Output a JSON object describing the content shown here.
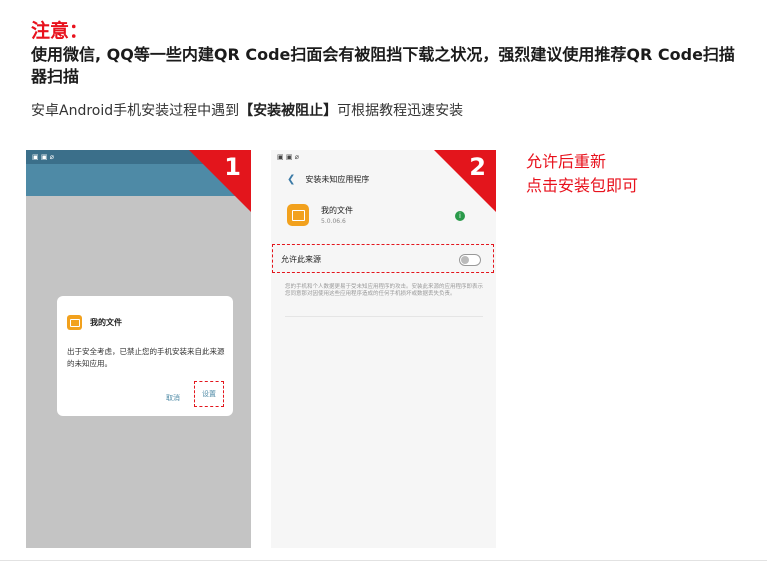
{
  "notice": {
    "title": "注意：",
    "warning": "使用微信, QQ等一些内建QR Code扫面会有被阻挡下载之状况，强烈建议使用推荐QR Code扫描器扫描",
    "sub_pre": "安卓Android手机安装过程中遇到",
    "sub_bold": "【安装被阻止】",
    "sub_post": "可根据教程迅速安装"
  },
  "phone1": {
    "status_left": "▣ ▣ ⌀",
    "status_right": "◀ ▣ ≋ .ıl 10",
    "step": "1",
    "dialog_title": "我的文件",
    "dialog_message": "出于安全考虑，已禁止您的手机安装来自此来源的未知应用。",
    "cancel": "取消",
    "settings": "设置"
  },
  "phone2": {
    "status_left": "▣ ▣ ⌀",
    "status_right": "◀ ▣ ≋ .ıl 10",
    "step": "2",
    "title": "安装未知应用程序",
    "app_name": "我的文件",
    "app_version": "5.0.06.6",
    "allow_label": "允许此来源",
    "description": "您的手机和个人数据更易于受未知应用程序的攻击。安装此来源的应用程序即表示您同意那对因使用这些应用程序造成的任何手机损坏或数据丢失负责。"
  },
  "side_note": {
    "line1": "允许后重新",
    "line2": "点击安装包即可"
  },
  "colors": {
    "accent": "#e8121d",
    "teal_bar": "#4e8aa6",
    "folder": "#f2a11d"
  }
}
